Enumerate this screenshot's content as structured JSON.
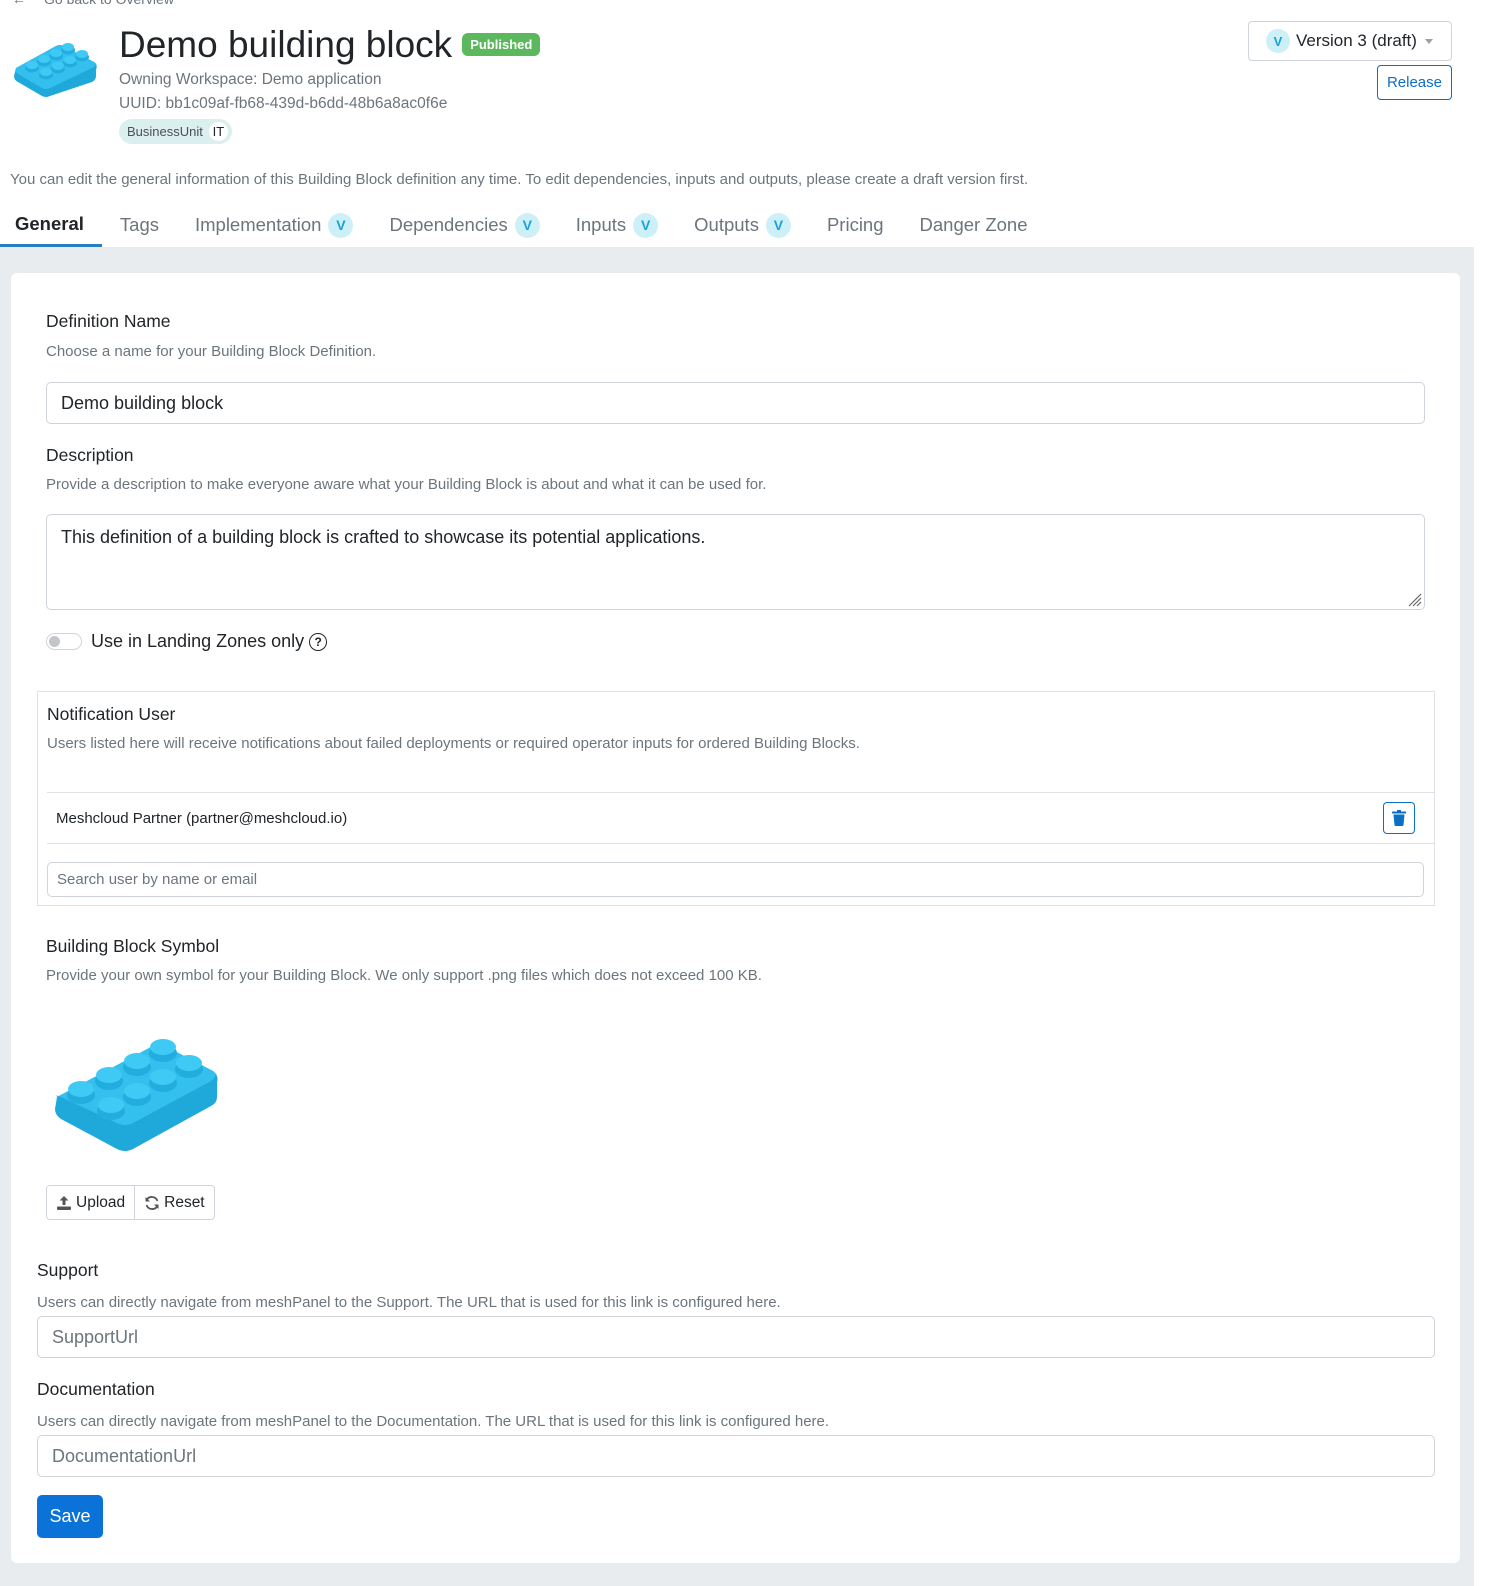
{
  "back_link": {
    "label": "Go back to Overview"
  },
  "header": {
    "title": "Demo building block",
    "status_badge": "Published",
    "owning_workspace": "Owning Workspace: Demo application",
    "uuid": "UUID: bb1c09af-fb68-439d-b6dd-48b6a8ac0f6e",
    "tag": {
      "key": "BusinessUnit",
      "value": "IT"
    },
    "version_select": {
      "badge": "V",
      "selected": "Version 3 (draft)"
    },
    "release_label": "Release",
    "icon": "lego-brick-icon"
  },
  "intro_text": "You can edit the general information of this Building Block definition any time. To edit dependencies, inputs and outputs, please create a draft version first.",
  "tabs": [
    {
      "label": "General",
      "active": true,
      "versioned": false
    },
    {
      "label": "Tags",
      "active": false,
      "versioned": false
    },
    {
      "label": "Implementation",
      "active": false,
      "versioned": true,
      "badge": "V"
    },
    {
      "label": "Dependencies",
      "active": false,
      "versioned": true,
      "badge": "V"
    },
    {
      "label": "Inputs",
      "active": false,
      "versioned": true,
      "badge": "V"
    },
    {
      "label": "Outputs",
      "active": false,
      "versioned": true,
      "badge": "V"
    },
    {
      "label": "Pricing",
      "active": false,
      "versioned": false
    },
    {
      "label": "Danger Zone",
      "active": false,
      "versioned": false
    }
  ],
  "form": {
    "definition_name": {
      "label": "Definition Name",
      "help": "Choose a name for your Building Block Definition.",
      "value": "Demo building block"
    },
    "description": {
      "label": "Description",
      "help": "Provide a description to make everyone aware what your Building Block is about and what it can be used for.",
      "value": "This definition of a building block is crafted to showcase its potential applications."
    },
    "landing_zones_toggle": {
      "label": "Use in Landing Zones only",
      "checked": false
    },
    "notification_user": {
      "label": "Notification User",
      "help": "Users listed here will receive notifications about failed deployments or required operator inputs for ordered Building Blocks.",
      "users": [
        {
          "display": "Meshcloud Partner (partner@meshcloud.io)"
        }
      ],
      "search_placeholder": "Search user by name or email"
    },
    "symbol": {
      "label": "Building Block Symbol",
      "help": "Provide your own symbol for your Building Block. We only support .png files which does not exceed 100 KB.",
      "upload_label": "Upload",
      "reset_label": "Reset"
    },
    "support": {
      "label": "Support",
      "help": "Users can directly navigate from meshPanel to the Support. The URL that is used for this link is configured here.",
      "placeholder": "SupportUrl",
      "value": ""
    },
    "documentation": {
      "label": "Documentation",
      "help": "Users can directly navigate from meshPanel to the Documentation. The URL that is used for this link is configured here.",
      "placeholder": "DocumentationUrl",
      "value": ""
    },
    "save_label": "Save"
  },
  "colors": {
    "accent": "#0b72d7",
    "published": "#5cb85c",
    "version_badge_bg": "#cdeff8",
    "version_badge_fg": "#17a2d8",
    "brick": "#29b6e8"
  }
}
